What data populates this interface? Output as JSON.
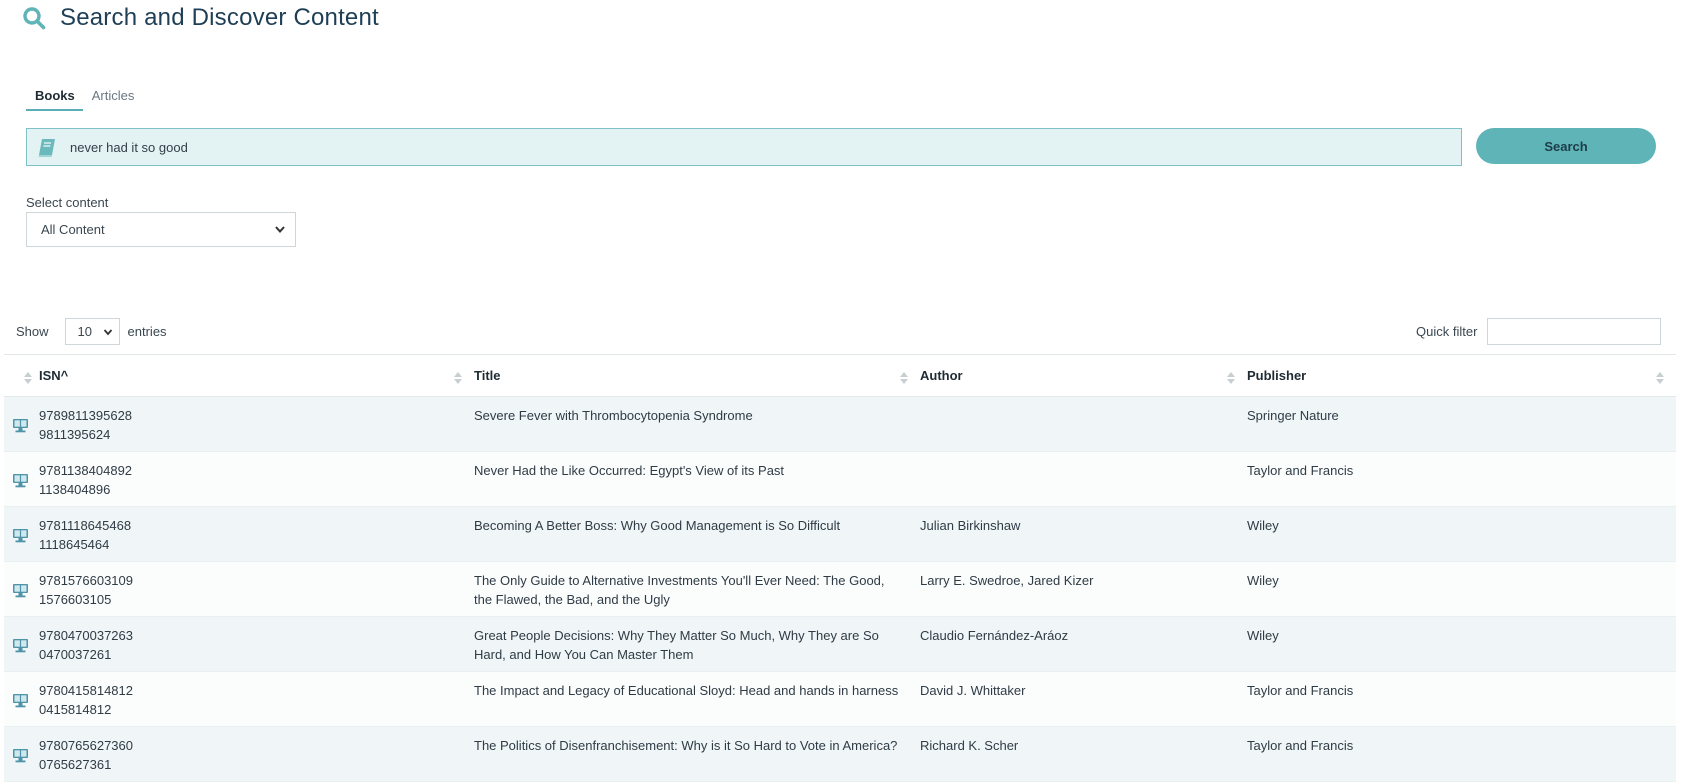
{
  "header": {
    "title": "Search and Discover Content",
    "icon": "search-icon"
  },
  "tabs": [
    {
      "label": "Books",
      "active": true
    },
    {
      "label": "Articles",
      "active": false
    }
  ],
  "search": {
    "value": "never had it so good",
    "button_label": "Search",
    "icon": "book-icon"
  },
  "content_filter": {
    "label": "Select content",
    "selected": "All Content"
  },
  "table_controls": {
    "show_label": "Show",
    "page_length": "10",
    "entries_label": "entries",
    "quick_filter_label": "Quick filter"
  },
  "table": {
    "columns": [
      "ISN^",
      "Title",
      "Author",
      "Publisher"
    ],
    "rows": [
      {
        "isbn13": "9789811395628",
        "isbn10": "9811395624",
        "title": "Severe Fever with Thrombocytopenia Syndrome",
        "author": "",
        "publisher": "Springer Nature"
      },
      {
        "isbn13": "9781138404892",
        "isbn10": "1138404896",
        "title": "Never Had the Like Occurred: Egypt's View of its Past",
        "author": "",
        "publisher": "Taylor and Francis"
      },
      {
        "isbn13": "9781118645468",
        "isbn10": "1118645464",
        "title": "Becoming A Better Boss: Why Good Management is So Difficult",
        "author": "Julian Birkinshaw",
        "publisher": "Wiley"
      },
      {
        "isbn13": "9781576603109",
        "isbn10": "1576603105",
        "title": "The Only Guide to Alternative Investments You'll Ever Need: The Good, the Flawed, the Bad, and the Ugly",
        "author": "Larry E. Swedroe, Jared Kizer",
        "publisher": "Wiley"
      },
      {
        "isbn13": "9780470037263",
        "isbn10": "0470037261",
        "title": "Great People Decisions: Why They Matter So Much, Why They are So Hard, and How You Can Master Them",
        "author": "Claudio Fernández-Aráoz",
        "publisher": "Wiley"
      },
      {
        "isbn13": "9780415814812",
        "isbn10": "0415814812",
        "title": "The Impact and Legacy of Educational Sloyd: Head and hands in harness",
        "author": "David J. Whittaker",
        "publisher": "Taylor and Francis"
      },
      {
        "isbn13": "9780765627360",
        "isbn10": "0765627361",
        "title": "The Politics of Disenfranchisement: Why is it So Hard to Vote in America?",
        "author": "Richard K. Scher",
        "publisher": "Taylor and Francis"
      }
    ]
  },
  "colors": {
    "accent": "#5fb4b8",
    "search_bg": "#e3f2f2",
    "title": "#1e3f55"
  }
}
